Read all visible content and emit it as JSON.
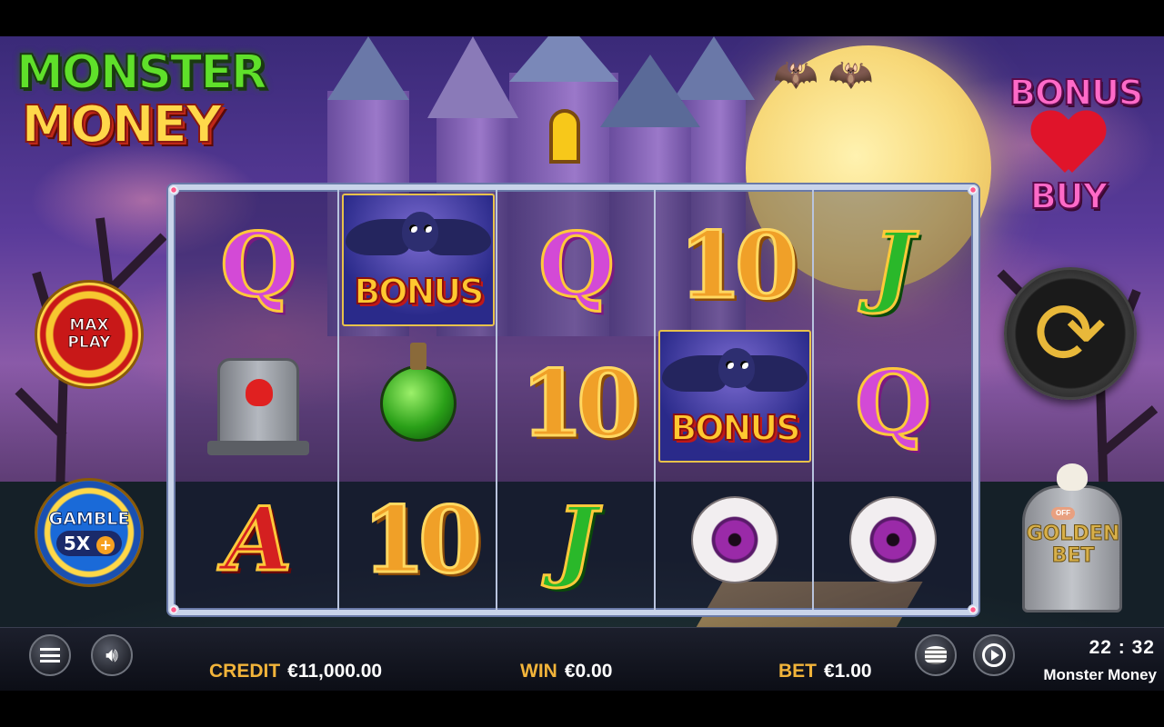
{
  "game": {
    "logo_line1": "MONSTER",
    "logo_line2": "MONEY",
    "name": "Monster Money"
  },
  "reels": [
    [
      "Q",
      "tombstone",
      "A"
    ],
    [
      "BONUS",
      "potion",
      "10"
    ],
    [
      "Q",
      "10",
      "J"
    ],
    [
      "10",
      "BONUS",
      "eyeball"
    ],
    [
      "J",
      "Q",
      "eyeball"
    ]
  ],
  "buttons": {
    "max_play": "MAX PLAY",
    "gamble_label": "GAMBLE",
    "gamble_multiplier": "5X",
    "gamble_plus": "+",
    "bonus_buy_line1": "BONUS",
    "bonus_buy_line2": "BUY",
    "golden_bet_toggle": "OFF",
    "golden_bet": "GOLDEN BET"
  },
  "status": {
    "credit_label": "CREDIT",
    "credit_value": "€11,000.00",
    "win_label": "WIN",
    "win_value": "€0.00",
    "bet_label": "BET",
    "bet_value": "€1.00",
    "clock": "22 : 32"
  },
  "icons": {
    "menu": "menu-icon",
    "sound": "speaker-icon",
    "coins": "coin-stack-icon",
    "autoplay": "autoplay-icon",
    "spin": "spin-arrows-icon"
  },
  "colors": {
    "label_gold": "#f2b43a",
    "reel_frame": "#c9d4ea",
    "max_play_red": "#c81818",
    "gamble_blue": "#1a6ad8"
  }
}
